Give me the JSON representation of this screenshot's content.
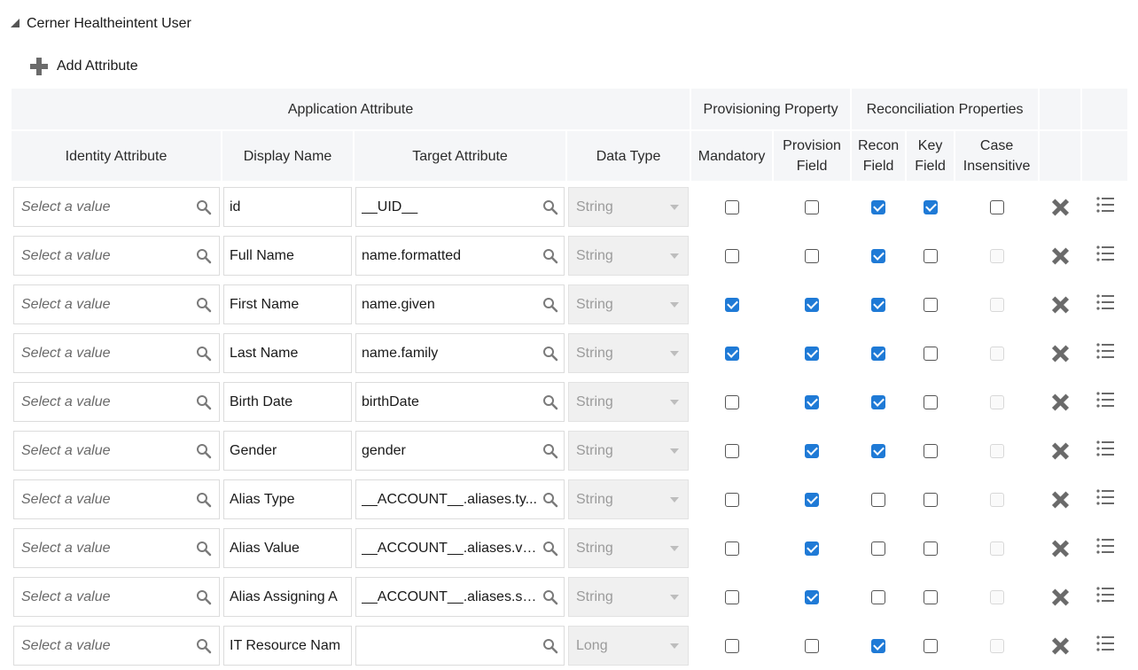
{
  "section": {
    "title": "Cerner Healtheintent User"
  },
  "toolbar": {
    "add_label": "Add Attribute"
  },
  "groups": {
    "application": "Application Attribute",
    "provisioning": "Provisioning Property",
    "reconciliation": "Reconciliation Properties"
  },
  "columns": {
    "identity": "Identity Attribute",
    "display": "Display Name",
    "target": "Target Attribute",
    "dtype": "Data Type",
    "mandatory": "Mandatory",
    "provision_l1": "Provision",
    "provision_l2": "Field",
    "recon_l1": "Recon",
    "recon_l2": "Field",
    "key_l1": "Key",
    "key_l2": "Field",
    "case_l1": "Case",
    "case_l2": "Insensitive"
  },
  "identity_placeholder": "Select a value",
  "icons": {
    "search": "search-icon",
    "delete": "close-icon",
    "details": "list-icon",
    "add": "plus-icon",
    "collapse": "collapse-triangle-icon"
  },
  "colors": {
    "checkbox_checked": "#1f7ad6",
    "header_bg": "#f5f6f8"
  },
  "rows": [
    {
      "display": "id",
      "target": "__UID__",
      "dtype": "String",
      "mandatory": false,
      "provision": false,
      "recon": true,
      "key": true,
      "case": false,
      "case_enabled": true
    },
    {
      "display": "Full Name",
      "target": "name.formatted",
      "dtype": "String",
      "mandatory": false,
      "provision": false,
      "recon": true,
      "key": false,
      "case": false,
      "case_enabled": false
    },
    {
      "display": "First Name",
      "target": "name.given",
      "dtype": "String",
      "mandatory": true,
      "provision": true,
      "recon": true,
      "key": false,
      "case": false,
      "case_enabled": false
    },
    {
      "display": "Last Name",
      "target": "name.family",
      "dtype": "String",
      "mandatory": true,
      "provision": true,
      "recon": true,
      "key": false,
      "case": false,
      "case_enabled": false
    },
    {
      "display": "Birth Date",
      "target": "birthDate",
      "dtype": "String",
      "mandatory": false,
      "provision": true,
      "recon": true,
      "key": false,
      "case": false,
      "case_enabled": false
    },
    {
      "display": "Gender",
      "target": "gender",
      "dtype": "String",
      "mandatory": false,
      "provision": true,
      "recon": true,
      "key": false,
      "case": false,
      "case_enabled": false
    },
    {
      "display": "Alias Type",
      "target": "__ACCOUNT__.aliases.ty...",
      "dtype": "String",
      "mandatory": false,
      "provision": true,
      "recon": false,
      "key": false,
      "case": false,
      "case_enabled": false
    },
    {
      "display": "Alias Value",
      "target": "__ACCOUNT__.aliases.va...",
      "dtype": "String",
      "mandatory": false,
      "provision": true,
      "recon": false,
      "key": false,
      "case": false,
      "case_enabled": false
    },
    {
      "display": "Alias Assigning A",
      "target": "__ACCOUNT__.aliases.sy...",
      "dtype": "String",
      "mandatory": false,
      "provision": true,
      "recon": false,
      "key": false,
      "case": false,
      "case_enabled": false
    },
    {
      "display": "IT Resource Nam",
      "target": "",
      "dtype": "Long",
      "mandatory": false,
      "provision": false,
      "recon": true,
      "key": false,
      "case": false,
      "case_enabled": false
    }
  ]
}
